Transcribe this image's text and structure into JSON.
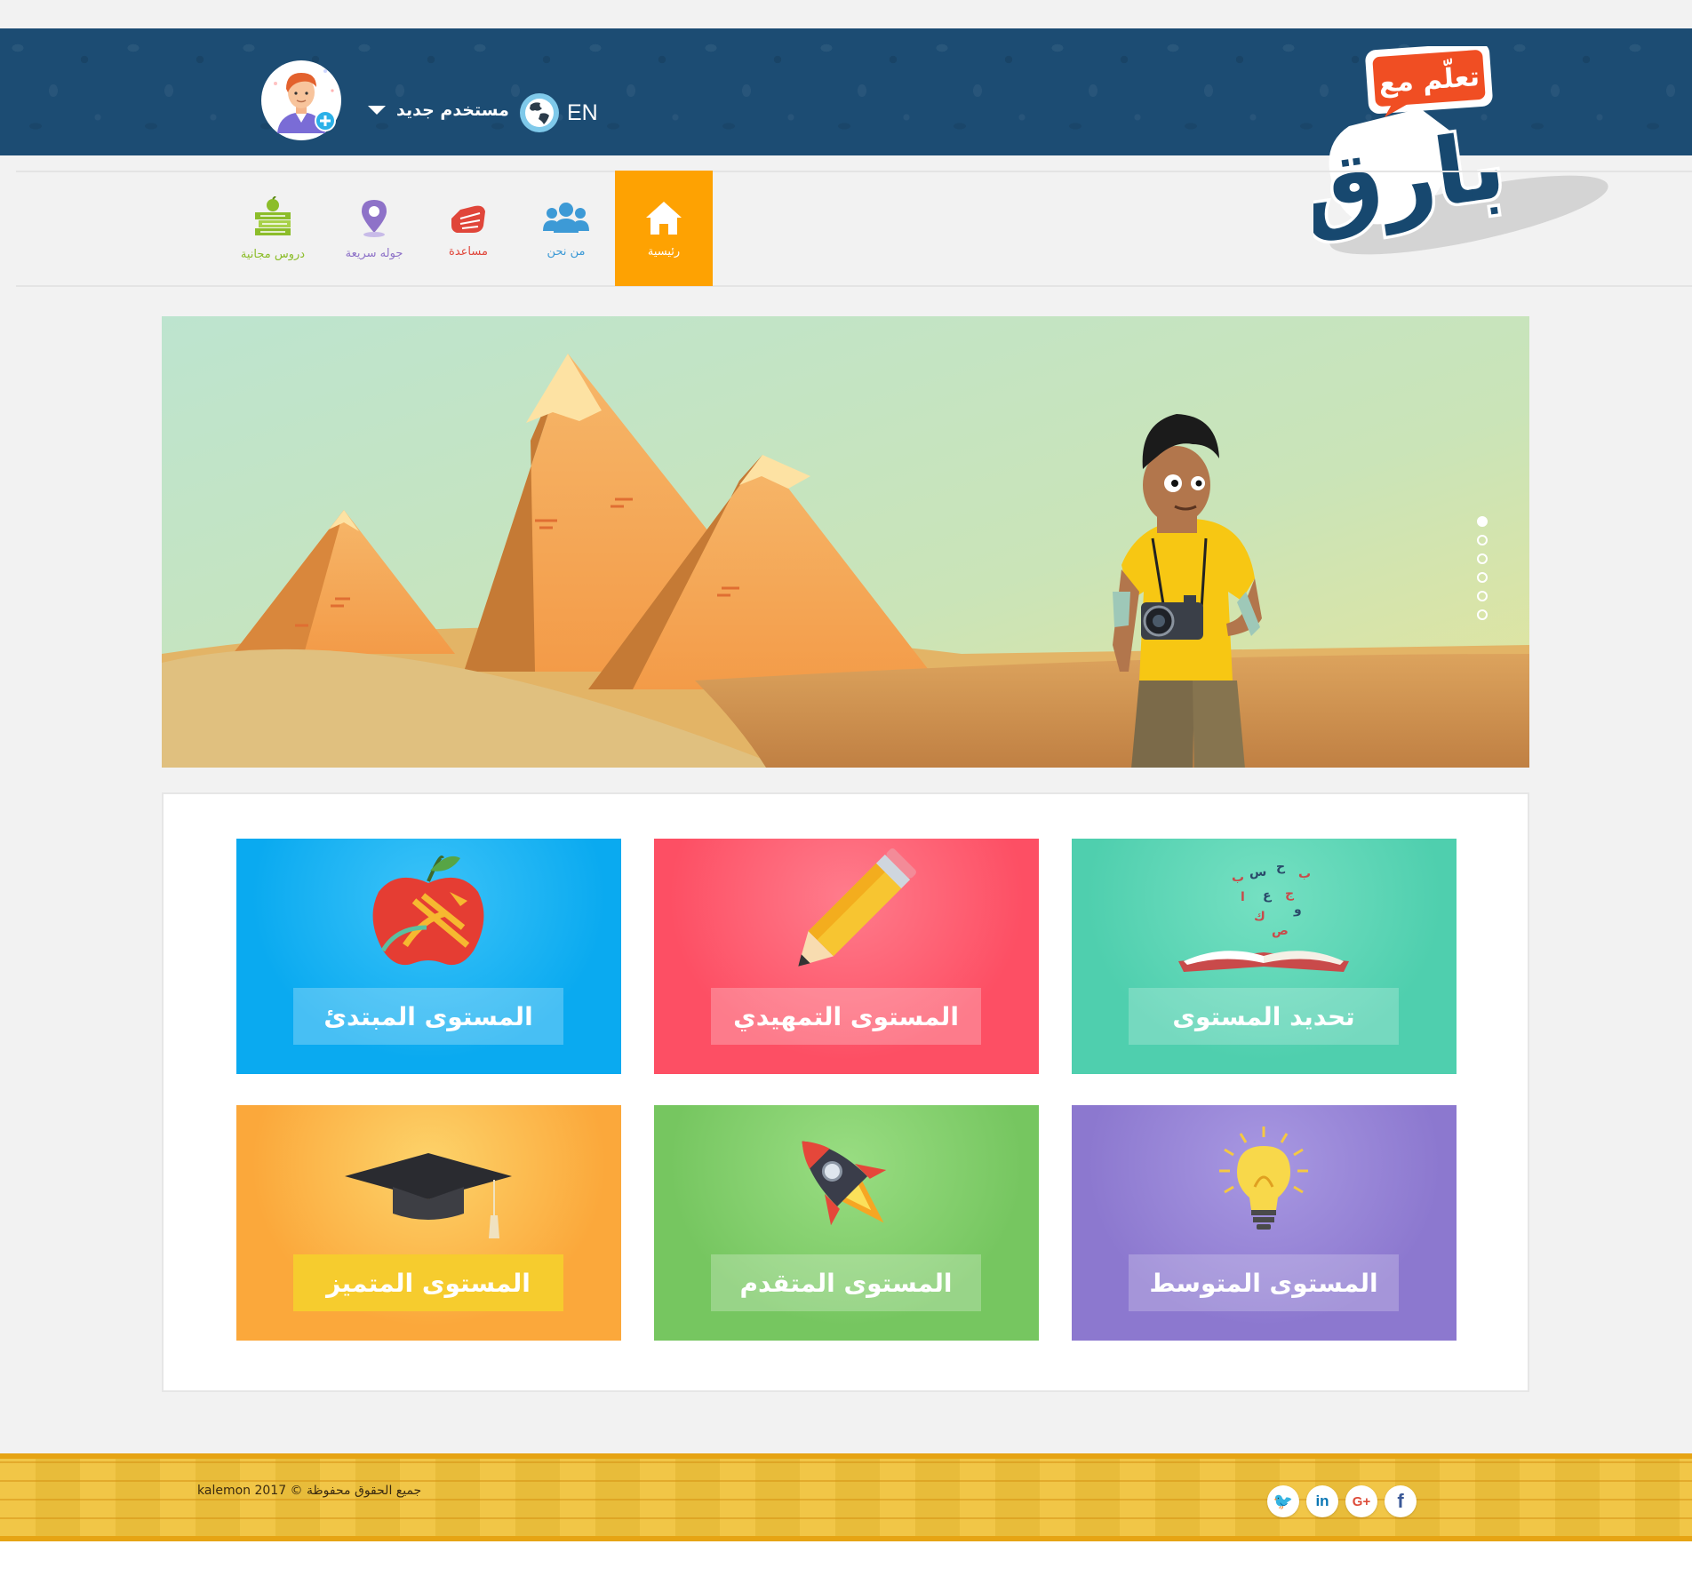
{
  "header": {
    "logo_text_top": "تعلّم مع",
    "logo_text_main": "بارق",
    "user_name": "مستخدم جديد",
    "language": "EN"
  },
  "nav": [
    {
      "label": "رئيسية",
      "icon": "home-icon",
      "color": "#ffffff",
      "active": true
    },
    {
      "label": "من نحن",
      "icon": "users-icon",
      "color": "#3d9ad6"
    },
    {
      "label": "مساعدة",
      "icon": "help-hand-icon",
      "color": "#e0463a"
    },
    {
      "label": "جوله سريعة",
      "icon": "location-pin-icon",
      "color": "#8e72c8"
    },
    {
      "label": "دروس مجانية",
      "icon": "books-icon",
      "color": "#8cbd2a"
    }
  ],
  "slider": {
    "active_slide": 1,
    "slide_count": 6
  },
  "levels": [
    {
      "label": "تحديد المستوى",
      "icon": "open-book-icon",
      "color": "#4fcfae"
    },
    {
      "label": "المستوى التمهيدي",
      "icon": "pencil-icon",
      "color": "#fd4f64"
    },
    {
      "label": "المستوى المبتدئ",
      "icon": "apple-icon",
      "color": "#0aaaf0"
    },
    {
      "label": "المستوى المتوسط",
      "icon": "lightbulb-icon",
      "color": "#8c78cf"
    },
    {
      "label": "المستوى المتقدم",
      "icon": "rocket-icon",
      "color": "#76c660"
    },
    {
      "label": "المستوى المتميز",
      "icon": "graduation-cap-icon",
      "color": "#fba83b"
    }
  ],
  "footer": {
    "copyright": "جميع الحقوق محفوظة © kalemon 2017",
    "social": [
      {
        "name": "twitter-icon",
        "glyph": "🐦"
      },
      {
        "name": "linkedin-icon",
        "glyph": "in"
      },
      {
        "name": "google-plus-icon",
        "glyph": "G+"
      },
      {
        "name": "facebook-icon",
        "glyph": "f"
      }
    ]
  }
}
